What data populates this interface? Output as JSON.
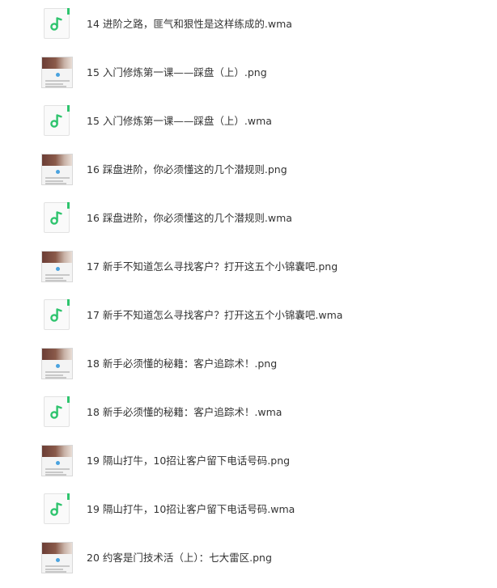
{
  "files": [
    {
      "name": "14 进阶之路，匪气和狠性是这样练成的.wma",
      "type": "wma",
      "icon": "music-note-icon"
    },
    {
      "name": "15 入门修炼第一课——踩盘（上）.png",
      "type": "png",
      "icon": "image-thumbnail"
    },
    {
      "name": "15 入门修炼第一课——踩盘（上）.wma",
      "type": "wma",
      "icon": "music-note-icon"
    },
    {
      "name": "16 踩盘进阶，你必须懂这的几个潜规则.png",
      "type": "png",
      "icon": "image-thumbnail"
    },
    {
      "name": "16 踩盘进阶，你必须懂这的几个潜规则.wma",
      "type": "wma",
      "icon": "music-note-icon"
    },
    {
      "name": "17 新手不知道怎么寻找客户？打开这五个小锦囊吧.png",
      "type": "png",
      "icon": "image-thumbnail"
    },
    {
      "name": "17 新手不知道怎么寻找客户？打开这五个小锦囊吧.wma",
      "type": "wma",
      "icon": "music-note-icon"
    },
    {
      "name": "18 新手必须懂的秘籍：客户追踪术！.png",
      "type": "png",
      "icon": "image-thumbnail"
    },
    {
      "name": "18 新手必须懂的秘籍：客户追踪术！.wma",
      "type": "wma",
      "icon": "music-note-icon"
    },
    {
      "name": "19 隔山打牛，10招让客户留下电话号码.png",
      "type": "png",
      "icon": "image-thumbnail"
    },
    {
      "name": "19 隔山打牛，10招让客户留下电话号码.wma",
      "type": "wma",
      "icon": "music-note-icon"
    },
    {
      "name": "20 约客是门技术活（上）：七大雷区.png",
      "type": "png",
      "icon": "image-thumbnail"
    }
  ],
  "colors": {
    "audio_accent": "#2fc46e",
    "text": "#333333"
  }
}
